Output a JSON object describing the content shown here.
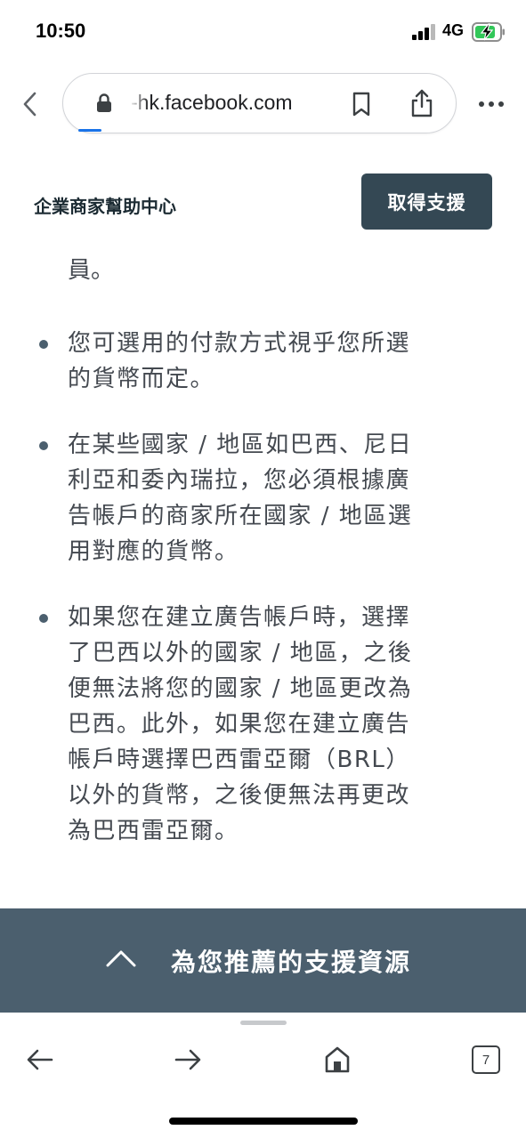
{
  "status_bar": {
    "time": "10:50",
    "network": "4G",
    "icons": [
      "signal-icon",
      "battery-charging-icon"
    ]
  },
  "browser": {
    "url": "-hk.facebook.com",
    "icons": [
      "back-chevron-icon",
      "lock-icon",
      "bookmark-icon",
      "share-icon",
      "more-icon"
    ],
    "tab_count": "7",
    "toolbar_icons": [
      "back-arrow-icon",
      "forward-arrow-icon",
      "home-icon",
      "tabs-icon"
    ]
  },
  "site": {
    "title": "企業商家幫助中心",
    "support_button": "取得支援"
  },
  "article": {
    "continuation": "員。",
    "bullets": [
      "您可選用的付款方式視乎您所選的貨幣而定。",
      "在某些國家 / 地區如巴西、尼日利亞和委內瑞拉，您必須根據廣告帳戶的商家所在國家 / 地區選用對應的貨幣。",
      "如果您在建立廣告帳戶時，選擇了巴西以外的國家 / 地區，之後便無法將您的國家 / 地區更改為巴西。此外，如果您在建立廣告帳戶時選擇巴西雷亞爾（BRL）以外的貨幣，之後便無法再更改為巴西雷亞爾。"
    ]
  },
  "resources_bar": {
    "label": "為您推薦的支援資源",
    "icon": "caret-up-icon"
  },
  "colors": {
    "button_bg": "#344854",
    "resources_bg": "#4b5f6e",
    "body_text": "#444950",
    "progress": "#1a73e8"
  }
}
